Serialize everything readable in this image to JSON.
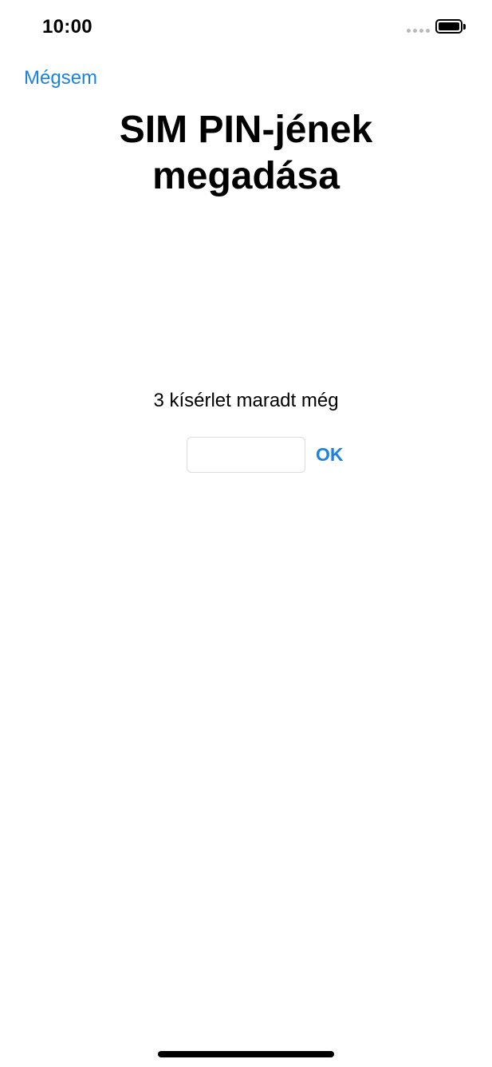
{
  "status_bar": {
    "time": "10:00"
  },
  "nav": {
    "cancel_label": "Mégsem"
  },
  "title": "SIM PIN-jének megadása",
  "attempts_remaining_text": "3 kísérlet maradt még",
  "pin_input": {
    "value": "",
    "placeholder": ""
  },
  "ok_label": "OK",
  "colors": {
    "accent": "#1a82e6",
    "text": "#000000",
    "background": "#ffffff"
  }
}
